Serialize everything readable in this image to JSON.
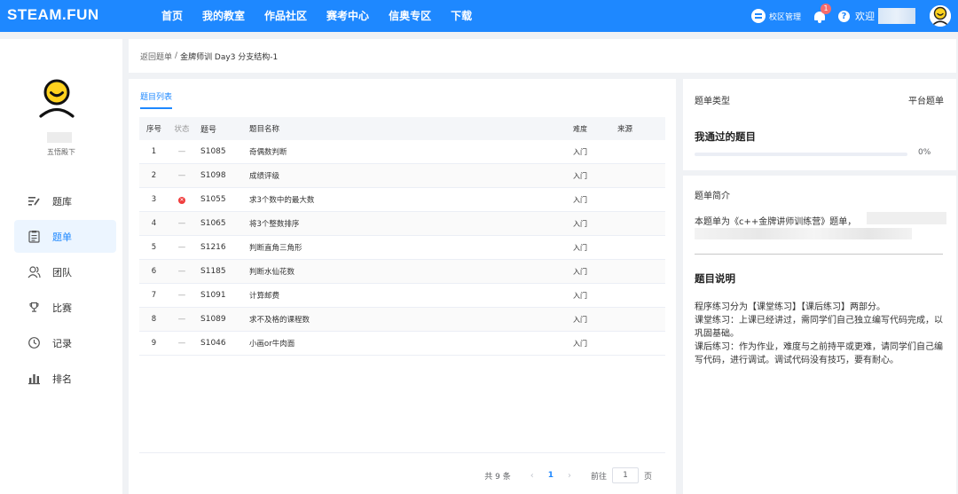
{
  "header": {
    "logo": "STEAM.FUN",
    "nav": [
      "首页",
      "我的教室",
      "作品社区",
      "赛考中心",
      "信奥专区",
      "下载"
    ],
    "campus_label": "校区管理",
    "notification_count": "1",
    "help_glyph": "?",
    "welcome": "欢迎"
  },
  "sidebar": {
    "school": "五悟殿下",
    "items": [
      {
        "label": "题库",
        "icon": "list-edit-icon"
      },
      {
        "label": "题单",
        "icon": "checklist-icon"
      },
      {
        "label": "团队",
        "icon": "team-icon"
      },
      {
        "label": "比赛",
        "icon": "trophy-icon"
      },
      {
        "label": "记录",
        "icon": "clock-icon"
      },
      {
        "label": "排名",
        "icon": "bar-chart-icon"
      }
    ],
    "active": "题单"
  },
  "breadcrumb": {
    "back": "返回题单",
    "separator": "/",
    "current": "金牌师训 Day3 分支结构-1"
  },
  "problem_list": {
    "tab": "题目列表",
    "columns": {
      "seq": "序号",
      "status": "状态",
      "id": "题号",
      "name": "题目名称",
      "difficulty": "难度",
      "source": "来源"
    },
    "rows": [
      {
        "seq": "1",
        "status": "—",
        "id": "S1085",
        "name": "奇偶数判断",
        "difficulty": "入门",
        "source": ""
      },
      {
        "seq": "2",
        "status": "—",
        "id": "S1098",
        "name": "成绩评级",
        "difficulty": "入门",
        "source": ""
      },
      {
        "seq": "3",
        "status": "✕",
        "id": "S1055",
        "name": "求3个数中的最大数",
        "difficulty": "入门",
        "source": ""
      },
      {
        "seq": "4",
        "status": "—",
        "id": "S1065",
        "name": "将3个整数排序",
        "difficulty": "入门",
        "source": ""
      },
      {
        "seq": "5",
        "status": "—",
        "id": "S1216",
        "name": "判断直角三角形",
        "difficulty": "入门",
        "source": ""
      },
      {
        "seq": "6",
        "status": "—",
        "id": "S1185",
        "name": "判断水仙花数",
        "difficulty": "入门",
        "source": ""
      },
      {
        "seq": "7",
        "status": "—",
        "id": "S1091",
        "name": "计算邮费",
        "difficulty": "入门",
        "source": ""
      },
      {
        "seq": "8",
        "status": "—",
        "id": "S1089",
        "name": "求不及格的课程数",
        "difficulty": "入门",
        "source": ""
      },
      {
        "seq": "9",
        "status": "—",
        "id": "S1046",
        "name": "小画or牛肉面",
        "difficulty": "入门",
        "source": ""
      }
    ],
    "pagination": {
      "total": "共 9 条",
      "prev": "‹",
      "current_page": "1",
      "next": "›",
      "goto_label": "前往",
      "goto_value": "1",
      "goto_unit": "页"
    }
  },
  "sheet_info": {
    "type_label": "题单类型",
    "type_value": "平台题单",
    "passed_title": "我通过的题目",
    "progress_value": 0,
    "progress_text": "0%",
    "intro_label": "题单简介",
    "intro_text": "本题单为《c++金牌讲师训练营》题单，",
    "description_title": "题目说明",
    "description_lines": [
      "程序练习分为【课堂练习】【课后练习】两部分。",
      "课堂练习：上课已经讲过，需同学们自己独立编写代码完成，以巩固基础。",
      "课后练习：作为作业，难度与之前持平或更难，请同学们自己编写代码，进行调试。调试代码没有技巧，要有耐心。"
    ]
  },
  "colors": {
    "primary": "#1e88ff",
    "error": "#f03d3d",
    "avatar_yellow": "#ffd21e"
  }
}
